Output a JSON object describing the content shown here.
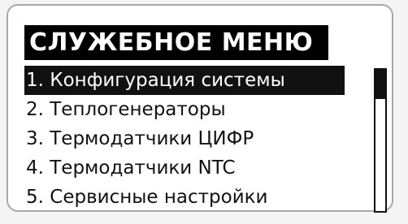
{
  "screen": {
    "title": "СЛУЖЕБНОЕ МЕНЮ"
  },
  "menu": {
    "selected_index": 0,
    "items": [
      {
        "label": "1. Конфигурация системы"
      },
      {
        "label": "2. Теплогенераторы"
      },
      {
        "label": "3. Термодатчики ЦИФР"
      },
      {
        "label": "4. Термодатчики NTC"
      },
      {
        "label": "5. Сервисные настройки"
      }
    ]
  },
  "colors": {
    "highlight": "#111111",
    "highlight_text": "#ffffff",
    "text": "#111111",
    "background": "#ffffff"
  }
}
